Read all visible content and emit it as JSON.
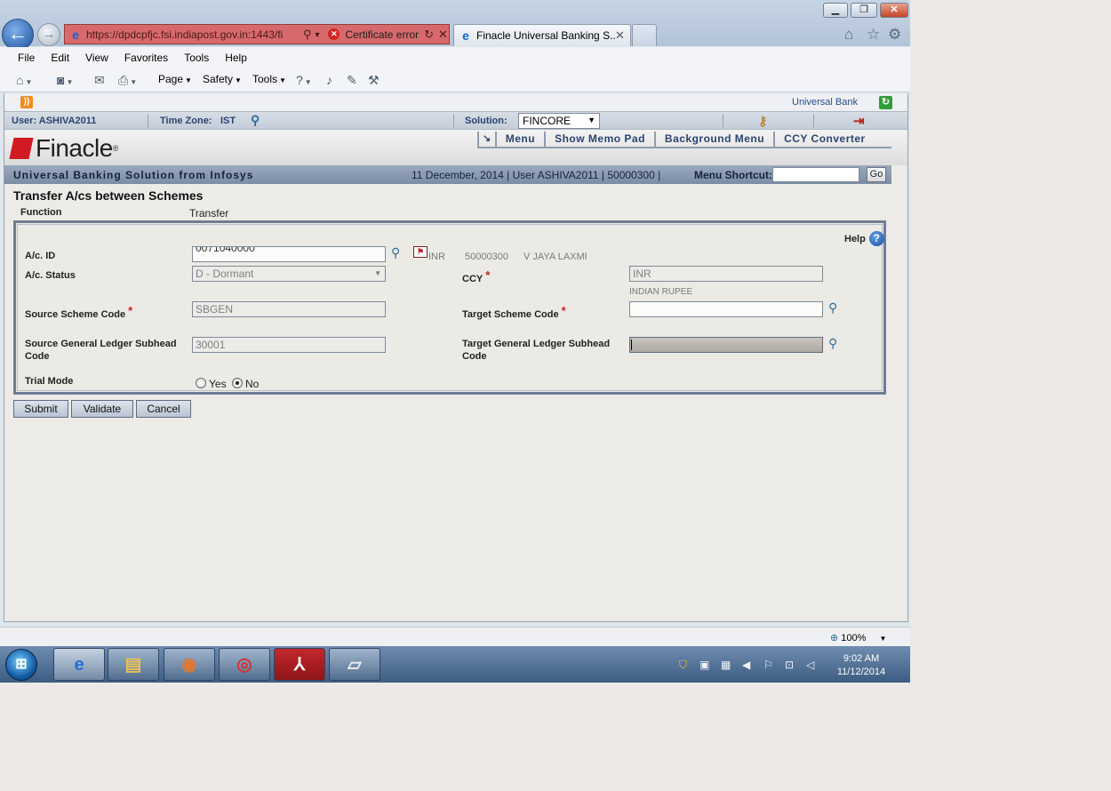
{
  "browser": {
    "url": "https://dpdcpfjc.fsi.indiapost.gov.in:1443/fi",
    "cert_error": "Certificate error",
    "tab_title": "Finacle Universal Banking S...",
    "menu": [
      "File",
      "Edit",
      "View",
      "Favorites",
      "Tools",
      "Help"
    ],
    "command": {
      "page": "Page",
      "safety": "Safety",
      "tools": "Tools"
    },
    "zoom": "100%"
  },
  "app": {
    "bank": "Universal Bank",
    "user_label": "User: ASHIVA2011",
    "tz_label": "Time Zone:",
    "tz_value": "IST",
    "solution_label": "Solution:",
    "solution_value": "FINCORE",
    "brand": "Finacle",
    "brand_reg": "®",
    "top_menu": [
      "Menu",
      "Show Memo Pad",
      "Background Menu",
      "CCY Converter"
    ],
    "tagline": "Universal Banking Solution from Infosys",
    "info": "11 December, 2014  |  User  ASHIVA2011  |  50000300  |",
    "shortcut_label": "Menu Shortcut:",
    "go": "Go"
  },
  "form": {
    "title": "Transfer A/cs between Schemes",
    "function_label": "Function",
    "function_value": "Transfer",
    "help": "Help",
    "acid_label": "A/c. ID",
    "acid_value": "0071040000",
    "acid_ccy": "INR",
    "acid_sol": "50000300",
    "acid_name": "V JAYA LAXMI",
    "status_label": "A/c. Status",
    "status_value": "D - Dormant",
    "ccy_label": "CCY",
    "ccy_value": "INR",
    "ccy_desc": "INDIAN RUPEE",
    "src_scheme_label": "Source Scheme Code",
    "src_scheme_value": "SBGEN",
    "tgt_scheme_label": "Target Scheme Code",
    "tgt_scheme_value": "",
    "src_gl_label_1": "Source General Ledger Subhead",
    "src_gl_label_2": "Code",
    "src_gl_value": "30001",
    "tgt_gl_label_1": "Target General Ledger Subhead",
    "tgt_gl_label_2": "Code",
    "tgt_gl_value": "",
    "trial_label": "Trial Mode",
    "trial_yes": "Yes",
    "trial_no": "No",
    "trial_selected": "No"
  },
  "buttons": {
    "submit": "Submit",
    "validate": "Validate",
    "cancel": "Cancel"
  },
  "taskbar": {
    "time": "9:02 AM",
    "date": "11/12/2014"
  }
}
